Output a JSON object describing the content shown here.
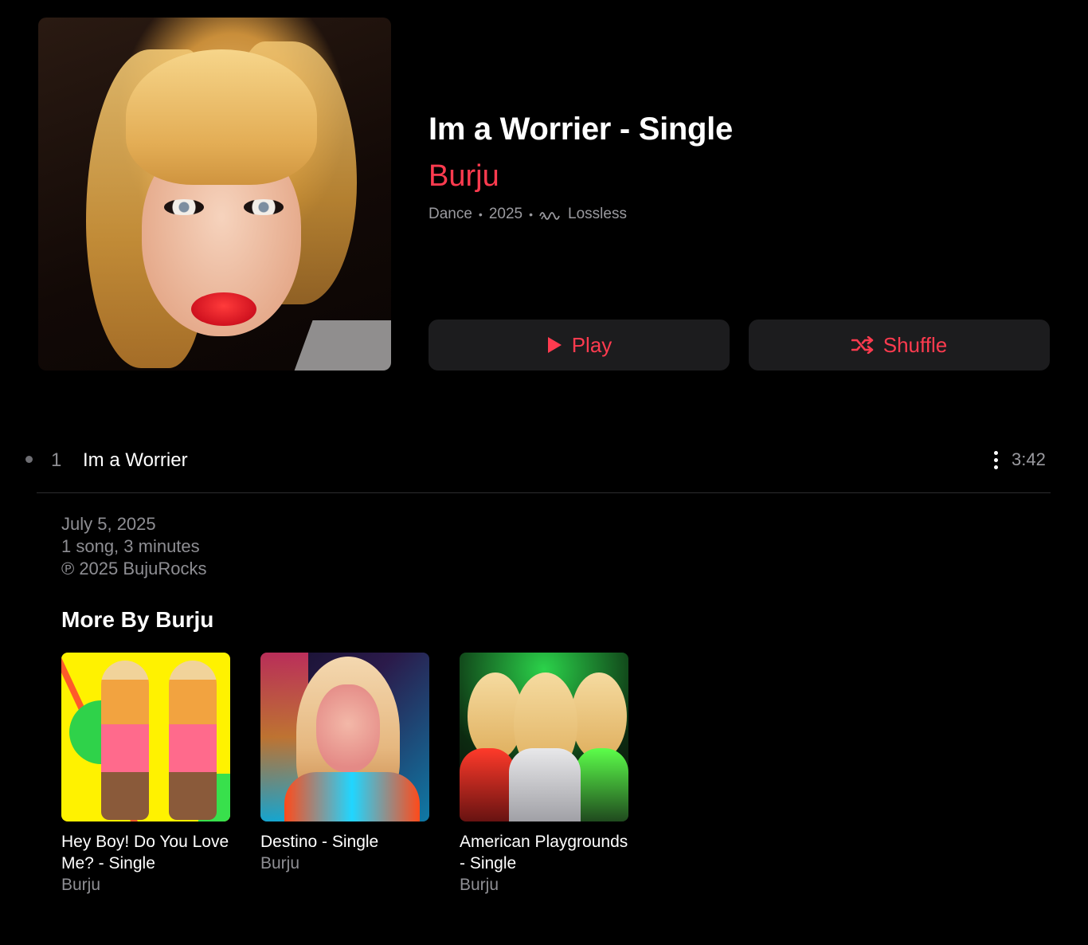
{
  "album": {
    "title": "Im a Worrier - Single",
    "artist": "Burju",
    "genre": "Dance",
    "year": "2025",
    "quality": "Lossless",
    "accent_color": "#ff3b4f"
  },
  "actions": {
    "play_label": "Play",
    "shuffle_label": "Shuffle"
  },
  "tracks": [
    {
      "number": "1",
      "title": "Im a Worrier",
      "duration": "3:42"
    }
  ],
  "info": {
    "release_date": "July 5, 2025",
    "summary": "1 song, 3 minutes",
    "copyright": "℗ 2025 BujuRocks"
  },
  "more_by": {
    "title": "More By Burju",
    "items": [
      {
        "name": "Hey Boy! Do You Love Me? - Single",
        "artist": "Burju"
      },
      {
        "name": "Destino - Single",
        "artist": "Burju"
      },
      {
        "name": "American Playgrounds - Single",
        "artist": "Burju"
      }
    ]
  }
}
